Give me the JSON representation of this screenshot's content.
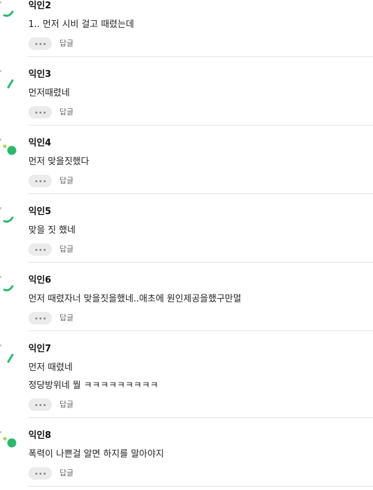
{
  "reply_label": "답글",
  "colors": {
    "accent_green": "#2db870",
    "light_green": "#a6d84a"
  },
  "comments": [
    {
      "author": "익인2",
      "avatar": "arc",
      "lines": [
        "1.. 먼저 시비 걸고 때렸는데"
      ]
    },
    {
      "author": "익인3",
      "avatar": "slash",
      "lines": [
        "먼저때렸네"
      ]
    },
    {
      "author": "익인4",
      "avatar": "dots",
      "lines": [
        "먼저 맞을짓했다"
      ]
    },
    {
      "author": "익인5",
      "avatar": "arc",
      "lines": [
        "맞을 짓 했네"
      ]
    },
    {
      "author": "익인6",
      "avatar": "arc",
      "lines": [
        "먼저 때렸자너 맞을짓을했네..애초에 원인제공을했구만멀"
      ]
    },
    {
      "author": "익인7",
      "avatar": "slash",
      "lines": [
        "먼저 때렸네",
        "정당방위네 뭘 ㅋㅋㅋㅋㅋㅋㅋㅋㅋ"
      ]
    },
    {
      "author": "익인8",
      "avatar": "dots",
      "lines": [
        "폭력이 나쁜걸 알면 하지를 말아야지"
      ]
    }
  ]
}
